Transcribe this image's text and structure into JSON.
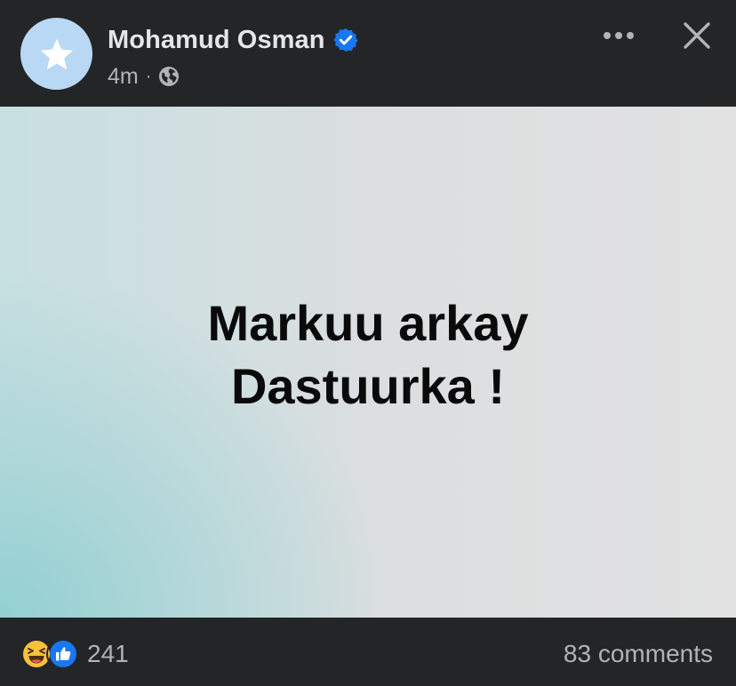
{
  "header": {
    "author_name": "Mohamud Osman",
    "timestamp": "4m",
    "separator": "·",
    "icons": {
      "avatar": "star-icon",
      "verified": "verified-badge-icon",
      "audience": "globe-icon",
      "more": "more-dots-icon",
      "close": "close-icon"
    }
  },
  "post": {
    "line1": "Markuu arkay",
    "line2": "Dastuurka !"
  },
  "footer": {
    "reaction_icons": [
      "haha-reaction-icon",
      "like-reaction-icon"
    ],
    "reaction_count": "241",
    "comments_label": "83 comments"
  },
  "colors": {
    "background": "#242526",
    "text_primary": "#e4e6eb",
    "text_secondary": "#b0b3b8",
    "verified_blue": "#1877f2",
    "avatar_blue": "#b9d8f4"
  }
}
